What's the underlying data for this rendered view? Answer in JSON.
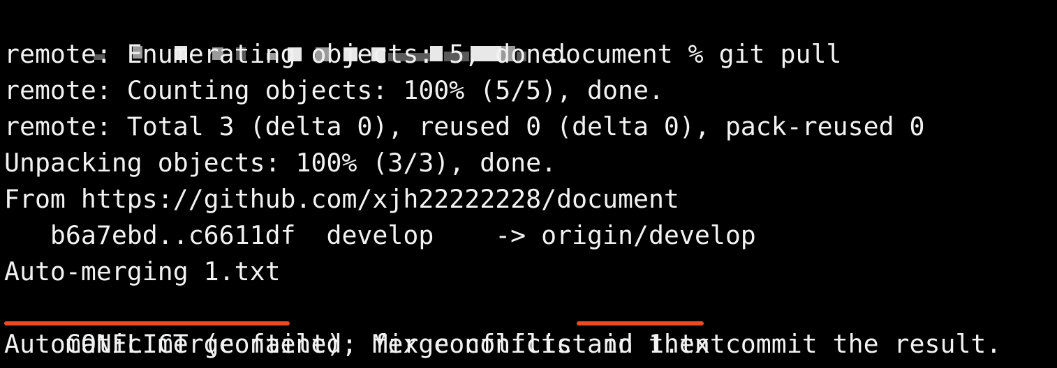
{
  "terminal": {
    "prompt_suffix": " document % git pull",
    "lines": [
      "remote: Enumerating objects: 5, done.",
      "remote: Counting objects: 100% (5/5), done.",
      "remote: Total 3 (delta 0), reused 0 (delta 0), pack-reused 0",
      "Unpacking objects: 100% (3/3), done.",
      "From https://github.com/xjh22222228/document",
      "   b6a7ebd..c6611df  develop    -> origin/develop",
      "Auto-merging 1.txt"
    ],
    "conflict": {
      "label": "CONFLICT (content)",
      "middle": ": Merge conflict in ",
      "file": "1.txt"
    },
    "final_line": "Automatic merge failed; fix conflicts and then commit the result."
  },
  "colors": {
    "background": "#000000",
    "text": "#f2f2f2",
    "highlight_underline": "#ee4a22"
  }
}
